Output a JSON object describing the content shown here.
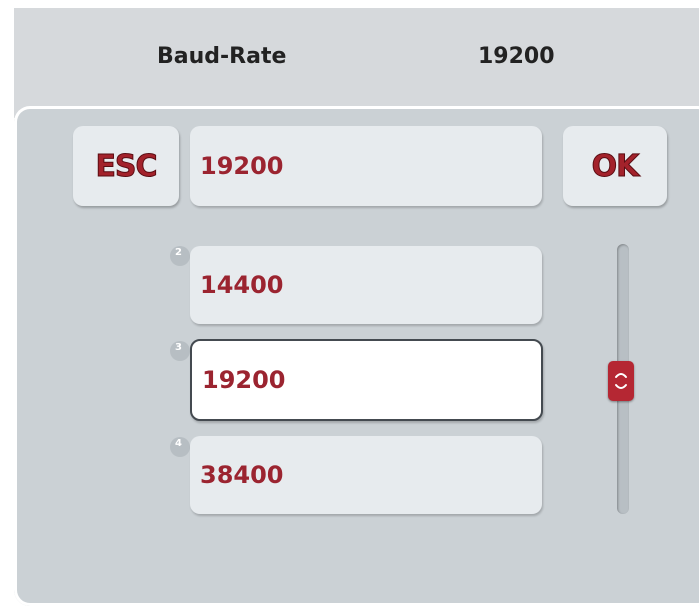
{
  "header": {
    "label": "Baud-Rate",
    "value": "19200"
  },
  "dialog": {
    "esc_label": "ESC",
    "ok_label": "OK",
    "input_value": "19200",
    "list": [
      {
        "index": "2",
        "value": "14400",
        "selected": false
      },
      {
        "index": "3",
        "value": "19200",
        "selected": true
      },
      {
        "index": "4",
        "value": "38400",
        "selected": false
      }
    ],
    "scrollbar_icon": "scroll-handle-icon"
  },
  "colors": {
    "accent": "#a3222b",
    "text_value": "#9b2430",
    "panel": "#cbd1d5",
    "button": "#e7ebee"
  }
}
